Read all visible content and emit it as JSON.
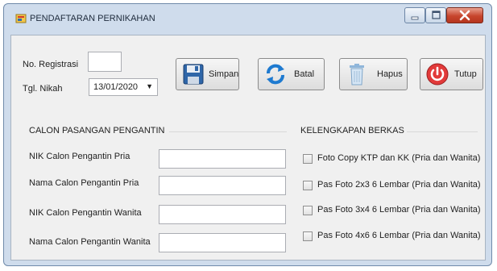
{
  "window": {
    "title": "PENDAFTARAN PERNIKAHAN"
  },
  "header": {
    "no_registrasi_label": "No. Registrasi",
    "no_registrasi_value": "",
    "tgl_nikah_label": "Tgl. Nikah",
    "tgl_nikah_value": "13/01/2020"
  },
  "toolbar": {
    "simpan": "Simpan",
    "batal": "Batal",
    "hapus": "Hapus",
    "tutup": "Tutup"
  },
  "calon": {
    "title": "CALON PASANGAN PENGANTIN",
    "fields": [
      {
        "label": "NIK Calon Pengantin Pria",
        "value": ""
      },
      {
        "label": "Nama Calon Pengantin Pria",
        "value": ""
      },
      {
        "label": "NIK Calon Pengantin Wanita",
        "value": ""
      },
      {
        "label": "Nama Calon Pengantin Wanita",
        "value": ""
      }
    ]
  },
  "berkas": {
    "title": "KELENGKAPAN BERKAS",
    "items": [
      {
        "label": "Foto Copy KTP dan KK (Pria dan Wanita)",
        "checked": false
      },
      {
        "label": "Pas Foto 2x3 6 Lembar (Pria dan Wanita)",
        "checked": false
      },
      {
        "label": "Pas Foto 3x4 6 Lembar (Pria dan Wanita)",
        "checked": false
      },
      {
        "label": "Pas Foto 4x6 6 Lembar (Pria dan Wanita)",
        "checked": false
      }
    ]
  },
  "colors": {
    "title_bar": "#cfdcec",
    "client": "#f0f0f0",
    "close": "#c7452d"
  }
}
